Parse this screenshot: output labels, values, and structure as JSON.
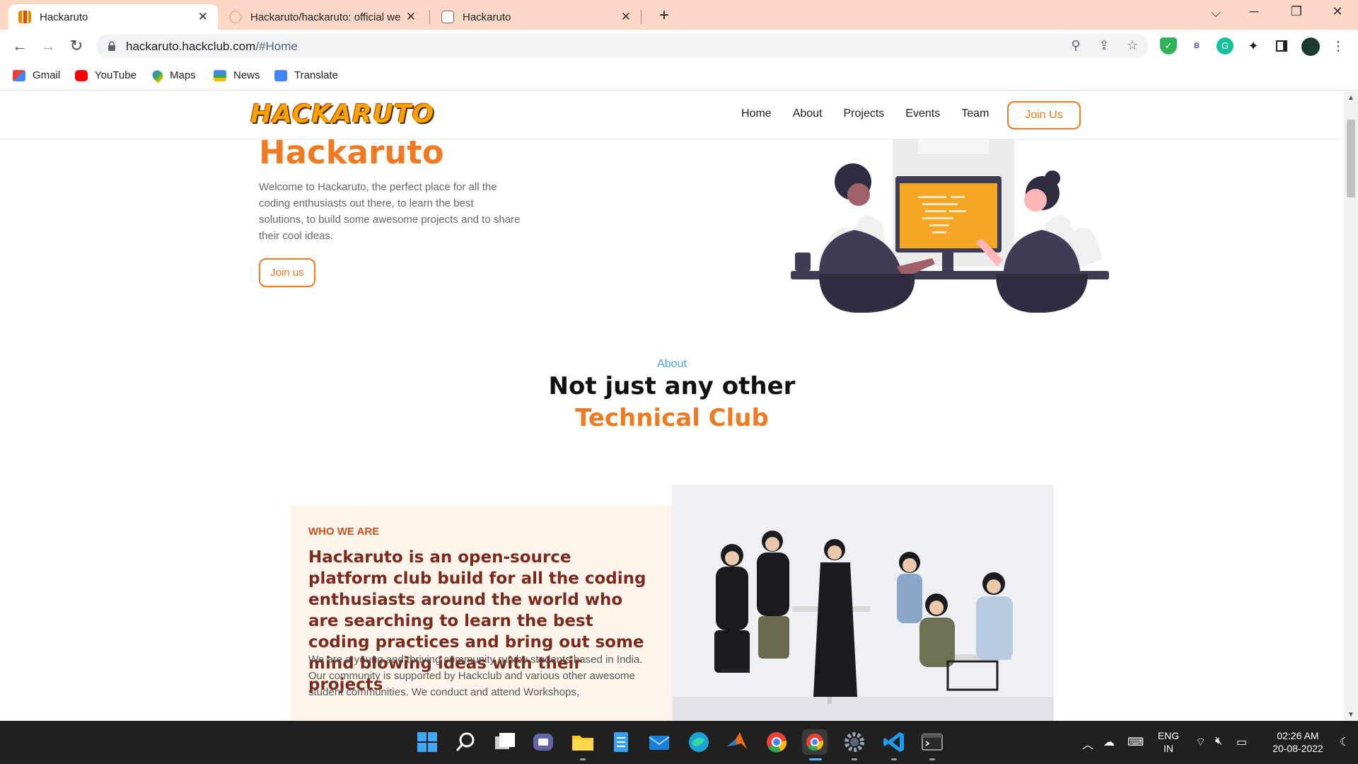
{
  "browser": {
    "tabs": [
      {
        "title": "Hackaruto",
        "active": true
      },
      {
        "title": "Hackaruto/hackaruto: official website",
        "active": false
      },
      {
        "title": "Hackaruto",
        "active": false
      }
    ],
    "new_tab": "+",
    "url_host": "hackaruto.hackclub.com",
    "url_path": "/#Home",
    "extension_letter": "B",
    "bookmarks": [
      "Gmail",
      "YouTube",
      "Maps",
      "News",
      "Translate"
    ]
  },
  "site": {
    "logo": "HACKARUTO",
    "nav": [
      "Home",
      "About",
      "Projects",
      "Events",
      "Team"
    ],
    "join_button": "Join Us",
    "hero": {
      "title": "Hackaruto",
      "text": "Welcome to Hackaruto, the perfect place for all the coding enthusiasts out there, to learn the best solutions, to build some awesome projects and to share their cool ideas.",
      "button": "Join us"
    },
    "about": {
      "kicker": "About",
      "heading": "Not just any other",
      "heading_accent": "Technical Club"
    },
    "who": {
      "kicker": "WHO WE ARE",
      "heading": "Hackaruto is an open-source platform club build for all the coding enthusiasts around the world who are searching to learn the best coding practices and bring out some mind blowing ideas with their projects",
      "body": "We are a young and thriving community run by students based in India. Our community is supported by Hackclub and various other awesome student communities. We conduct and attend Workshops,"
    }
  },
  "taskbar": {
    "lang_top": "ENG",
    "lang_bottom": "IN",
    "time": "02:26 AM",
    "date": "20-08-2022"
  },
  "colors": {
    "accent": "#f07a22",
    "tabbar": "#fbd7c6",
    "link_blue": "#4aa3df",
    "who_heading": "#7a2a1e"
  }
}
